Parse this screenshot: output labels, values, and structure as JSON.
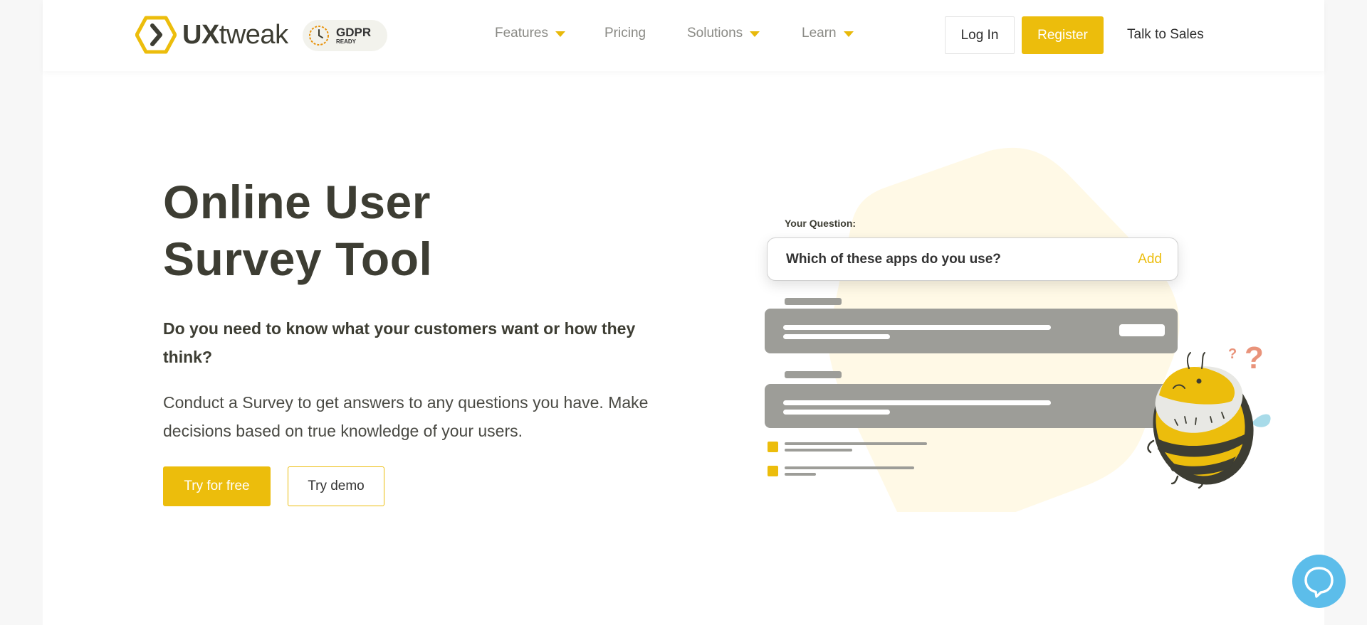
{
  "header": {
    "logo": {
      "brand_bold": "UX",
      "brand_light": "tweak"
    },
    "gdpr": {
      "main": "GDPR",
      "sub": "READY"
    },
    "nav": [
      {
        "label": "Features",
        "has_dropdown": true
      },
      {
        "label": "Pricing",
        "has_dropdown": false
      },
      {
        "label": "Solutions",
        "has_dropdown": true
      },
      {
        "label": "Learn",
        "has_dropdown": true
      }
    ],
    "login_label": "Log In",
    "register_label": "Register",
    "talk_sales_label": "Talk to Sales"
  },
  "hero": {
    "title_line1": "Online User",
    "title_line2": "Survey Tool",
    "subtitle": "Do you need to know what your customers want or how they think?",
    "description": "Conduct a Survey to get answers to any questions you have. Make decisions based on true knowledge of your users.",
    "try_free_label": "Try for free",
    "try_demo_label": "Try demo"
  },
  "illustration": {
    "question_label": "Your Question:",
    "question_text": "Which of these apps do you use?",
    "add_label": "Add",
    "question_marks": "?",
    "question_marks_big": "?"
  },
  "icons": {
    "logo": "hexagon-chevron-icon",
    "gdpr": "clock-badge-icon",
    "dropdown": "caret-down-icon",
    "chat": "chat-bubble-icon",
    "mascot": "bee-mascot-icon"
  },
  "colors": {
    "accent": "#ecbd0c",
    "text_dark": "#3d3d33",
    "nav_text": "#8a8a85",
    "illustration_bg": "#fff9e6",
    "card_gray": "#9d9d98",
    "chat": "#5cbdea",
    "question_marks": "#e9937a"
  }
}
